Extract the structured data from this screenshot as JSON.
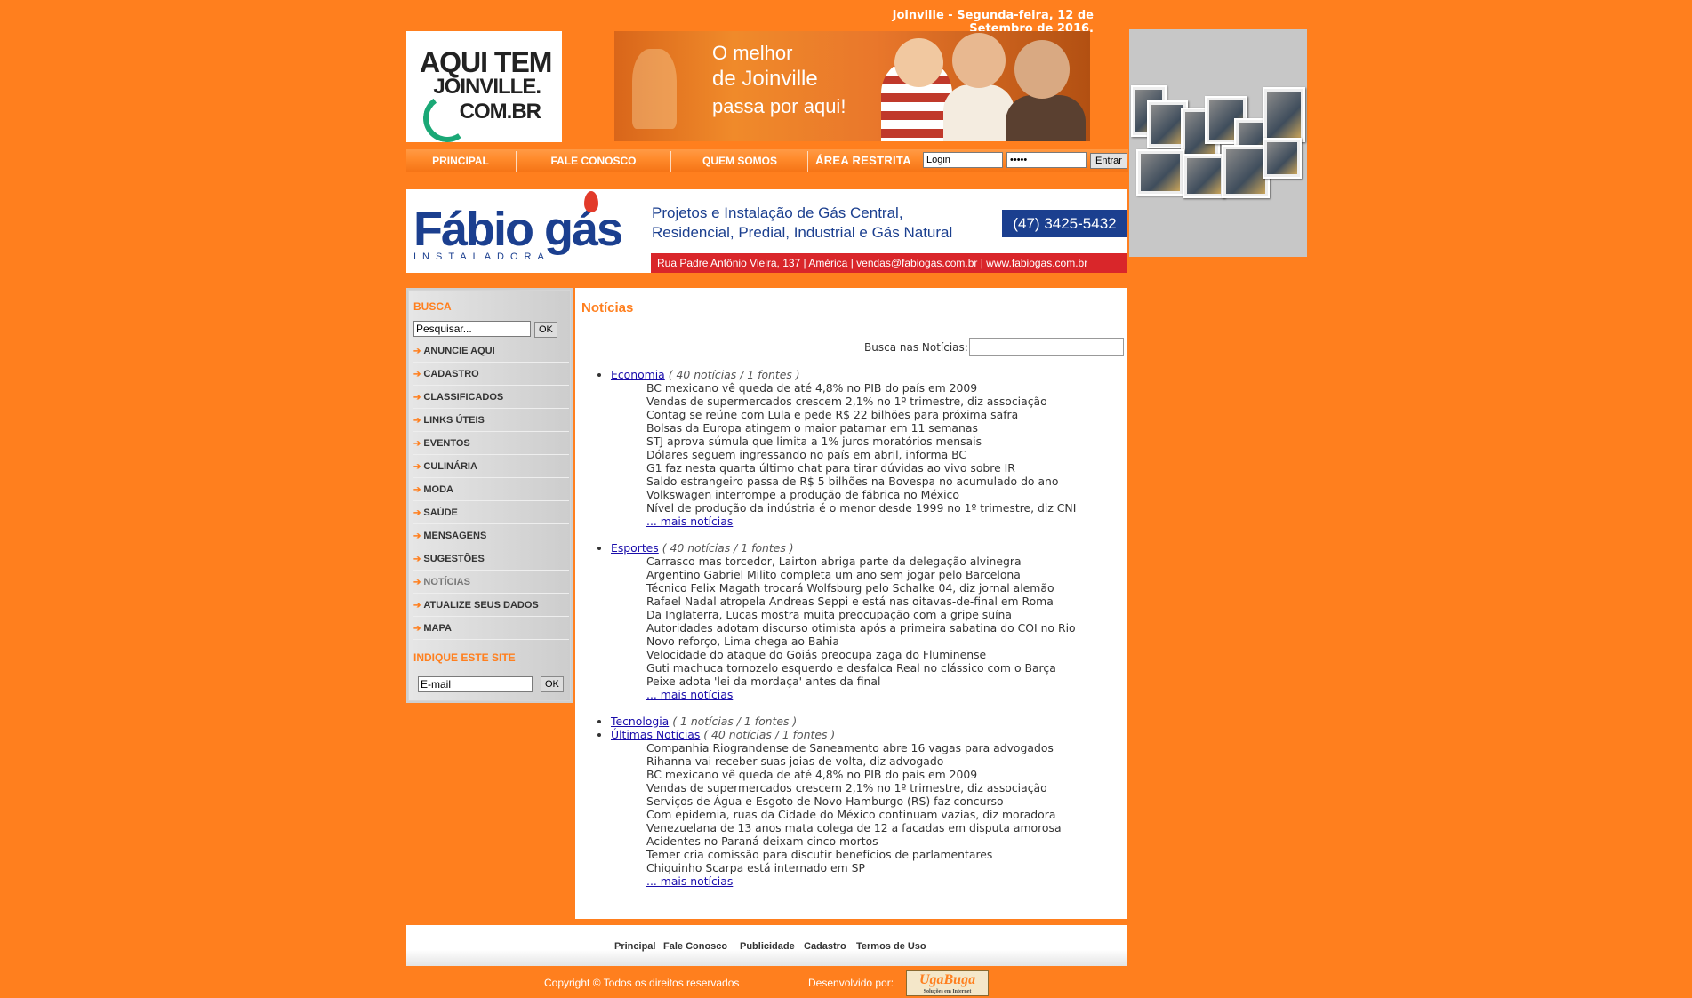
{
  "header": {
    "date": "Joinville - Segunda-feira, 12 de Setembro de 2016.",
    "logo": {
      "line1": "AQUI TEM",
      "line2": "JOINVILLE.",
      "line3": "COM.BR"
    },
    "banner": {
      "line1": "O melhor",
      "line2": "de Joinville",
      "line3": "passa por aqui!"
    }
  },
  "nav": {
    "items": [
      "PRINCIPAL",
      "FALE CONOSCO",
      "QUEM SOMOS"
    ],
    "restricted_label": "ÁREA RESTRITA",
    "login_value": "Login",
    "password_value": "•••••",
    "enter_button": "Entrar"
  },
  "advertiser": {
    "brand": "Fábio gás",
    "sub": "INSTALADORA",
    "desc_line1": "Projetos e Instalação de Gás Central,",
    "desc_line2": "Residencial, Predial, Industrial e Gás Natural",
    "phone": "(47) 3425-5432",
    "address": "Rua Padre Antônio Vieira, 137 | América | vendas@fabiogas.com.br | www.fabiogas.com.br"
  },
  "sidebar": {
    "search_title": "BUSCA",
    "search_value": "Pesquisar...",
    "ok": "OK",
    "items": [
      "ANUNCIE AQUI",
      "CADASTRO",
      "CLASSIFICADOS",
      "LINKS ÚTEIS",
      "EVENTOS",
      "CULINÁRIA",
      "MODA",
      "SAÚDE",
      "MENSAGENS",
      "SUGESTÕES",
      "NOTÍCIAS",
      "ATUALIZE SEUS DADOS",
      "MAPA"
    ],
    "indicate_title": "INDIQUE ESTE SITE",
    "email_value": "E-mail"
  },
  "main": {
    "title": "Notícias",
    "search_label": "Busca nas Notícias:",
    "more_label": "... mais notícias",
    "categories": [
      {
        "name": "Economia",
        "meta": "( 40 notícias / 1 fontes )",
        "items": [
          "BC mexicano vê queda de até 4,8% no PIB do país em 2009",
          "Vendas de supermercados crescem 2,1% no 1º trimestre, diz associação",
          "Contag se reúne com Lula e pede R$ 22 bilhões para próxima safra",
          "Bolsas da Europa atingem o maior patamar em 11 semanas",
          "STJ aprova súmula que limita a 1% juros moratórios mensais",
          "Dólares seguem ingressando no país em abril, informa BC",
          "G1 faz nesta quarta último chat para tirar dúvidas ao vivo sobre IR",
          "Saldo estrangeiro passa de R$ 5 bilhões na Bovespa no acumulado do ano",
          "Volkswagen interrompe a produção de fábrica no México",
          "Nível de produção da indústria é o menor desde 1999 no 1º trimestre, diz CNI"
        ],
        "more": true
      },
      {
        "name": "Esportes",
        "meta": "( 40 notícias / 1 fontes )",
        "items": [
          "Carrasco mas torcedor, Lairton abriga parte da delegação alvinegra",
          "Argentino Gabriel Milito completa um ano sem jogar pelo Barcelona",
          "Técnico Felix Magath trocará Wolfsburg pelo Schalke 04, diz jornal alemão",
          "Rafael Nadal atropela Andreas Seppi e está nas oitavas-de-final em Roma",
          "Da Inglaterra, Lucas mostra muita preocupação com a gripe suína",
          "Autoridades adotam discurso otimista após a primeira sabatina do COI no Rio",
          "Novo reforço, Lima chega ao Bahia",
          "Velocidade do ataque do Goiás preocupa zaga do Fluminense",
          "Guti machuca tornozelo esquerdo e desfalca Real no clássico com o Barça",
          "Peixe adota 'lei da mordaça' antes da final"
        ],
        "more": true
      },
      {
        "name": "Tecnologia",
        "meta": "( 1 notícias / 1 fontes )",
        "items": [],
        "more": false
      },
      {
        "name": "Últimas Notícias",
        "meta": "( 40 notícias / 1 fontes )",
        "items": [
          "Companhia Riograndense de Saneamento abre 16 vagas para advogados",
          "Rihanna vai receber suas joias de volta, diz advogado",
          "BC mexicano vê queda de até 4,8% no PIB do país em 2009",
          "Vendas de supermercados crescem 2,1% no 1º trimestre, diz associação",
          "Serviços de Água e Esgoto de Novo Hamburgo (RS) faz concurso",
          "Com epidemia, ruas da Cidade do México continuam vazias, diz moradora",
          "Venezuelana de 13 anos mata colega de 12 a facadas em disputa amorosa",
          "Acidentes no Paraná deixam cinco mortos",
          "Temer cria comissão para discutir benefícios de parlamentares",
          "Chiquinho Scarpa está internado em SP"
        ],
        "more": true
      }
    ]
  },
  "footer": {
    "links": [
      "Principal",
      "Fale Conosco",
      "Publicidade",
      "Cadastro",
      "Termos de Uso"
    ],
    "copyright": "Copyright © Todos os direitos reservados",
    "developed_by": "Desenvolvido por:",
    "dev_logo": "UgaBuga",
    "dev_logo_sub": "Soluções em Internet"
  },
  "colors": {
    "background": "#ff7f1e",
    "accent": "#ff7f1e",
    "link": "#1a0dab",
    "brand_blue": "#1b3f8f",
    "brand_red": "#d9262a"
  }
}
